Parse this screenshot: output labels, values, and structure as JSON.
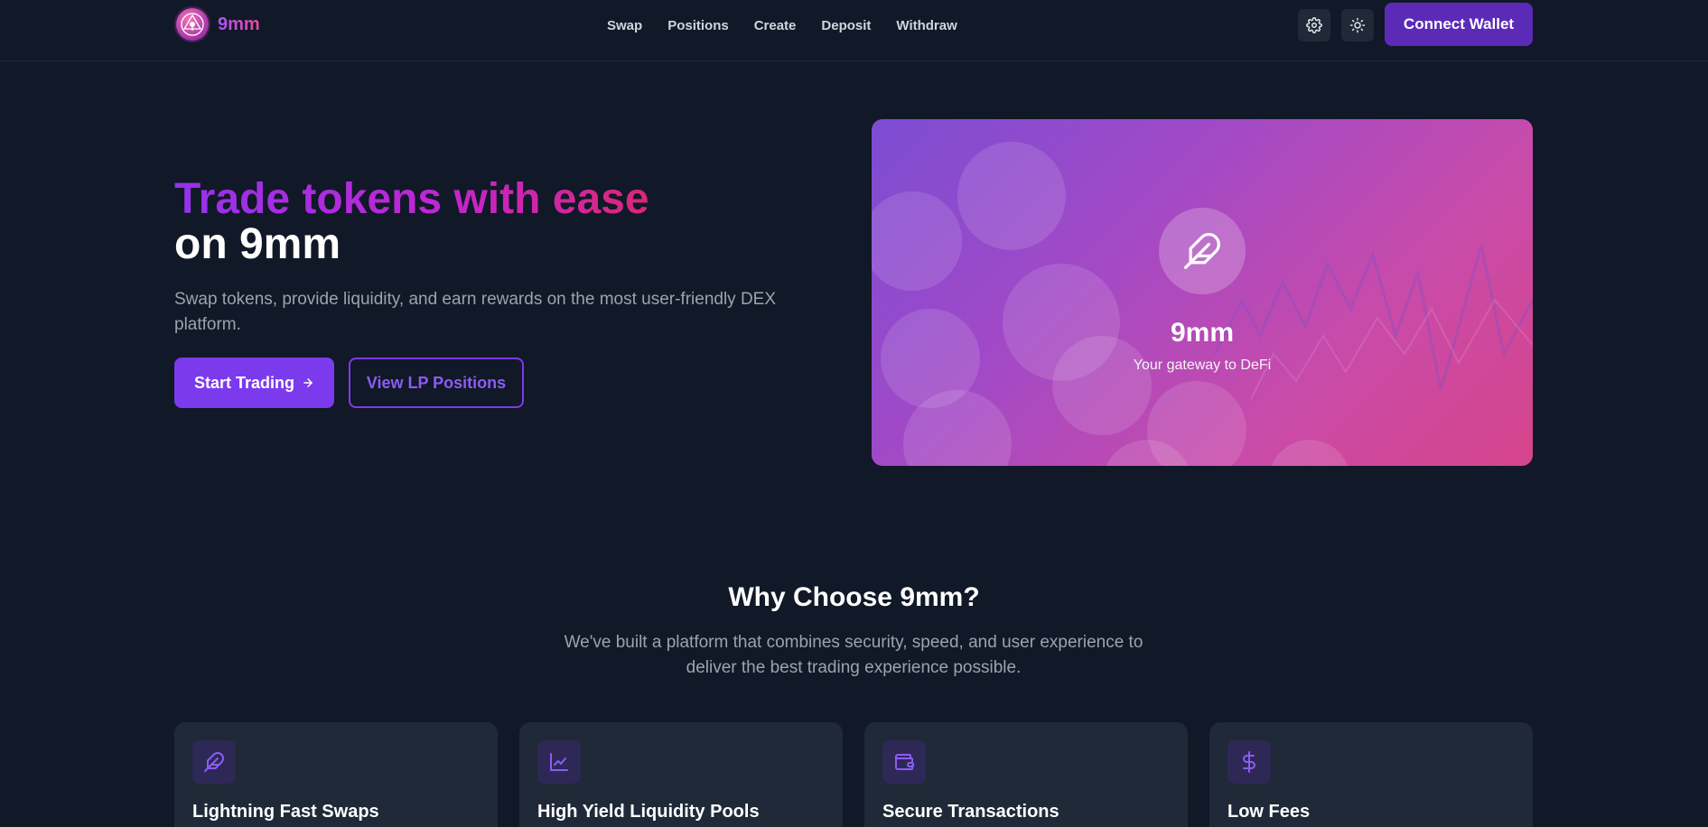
{
  "header": {
    "brand": "9mm",
    "nav": [
      "Swap",
      "Positions",
      "Create",
      "Deposit",
      "Withdraw"
    ],
    "connect_label": "Connect Wallet",
    "icons": [
      "gear-icon",
      "sun-icon"
    ]
  },
  "hero": {
    "title_gradient": "Trade tokens with ease",
    "title_plain": "on 9mm",
    "subtitle": "Swap tokens, provide liquidity, and earn rewards on the most user-friendly DEX platform.",
    "primary_cta": "Start Trading",
    "secondary_cta": "View LP Positions",
    "card_title": "9mm",
    "card_subtitle": "Your gateway to DeFi"
  },
  "why": {
    "title": "Why Choose 9mm?",
    "subtitle": "We've built a platform that combines security, speed, and user experience to deliver the best trading experience possible.",
    "features": [
      {
        "title": "Lightning Fast Swaps",
        "icon": "feather-icon"
      },
      {
        "title": "High Yield Liquidity Pools",
        "icon": "chart-icon"
      },
      {
        "title": "Secure Transactions",
        "icon": "wallet-icon"
      },
      {
        "title": "Low Fees",
        "icon": "dollar-icon"
      }
    ]
  },
  "colors": {
    "background": "#111827",
    "accent": "#7c3aed",
    "gradient_start": "#9333ea",
    "gradient_end": "#db2777"
  }
}
